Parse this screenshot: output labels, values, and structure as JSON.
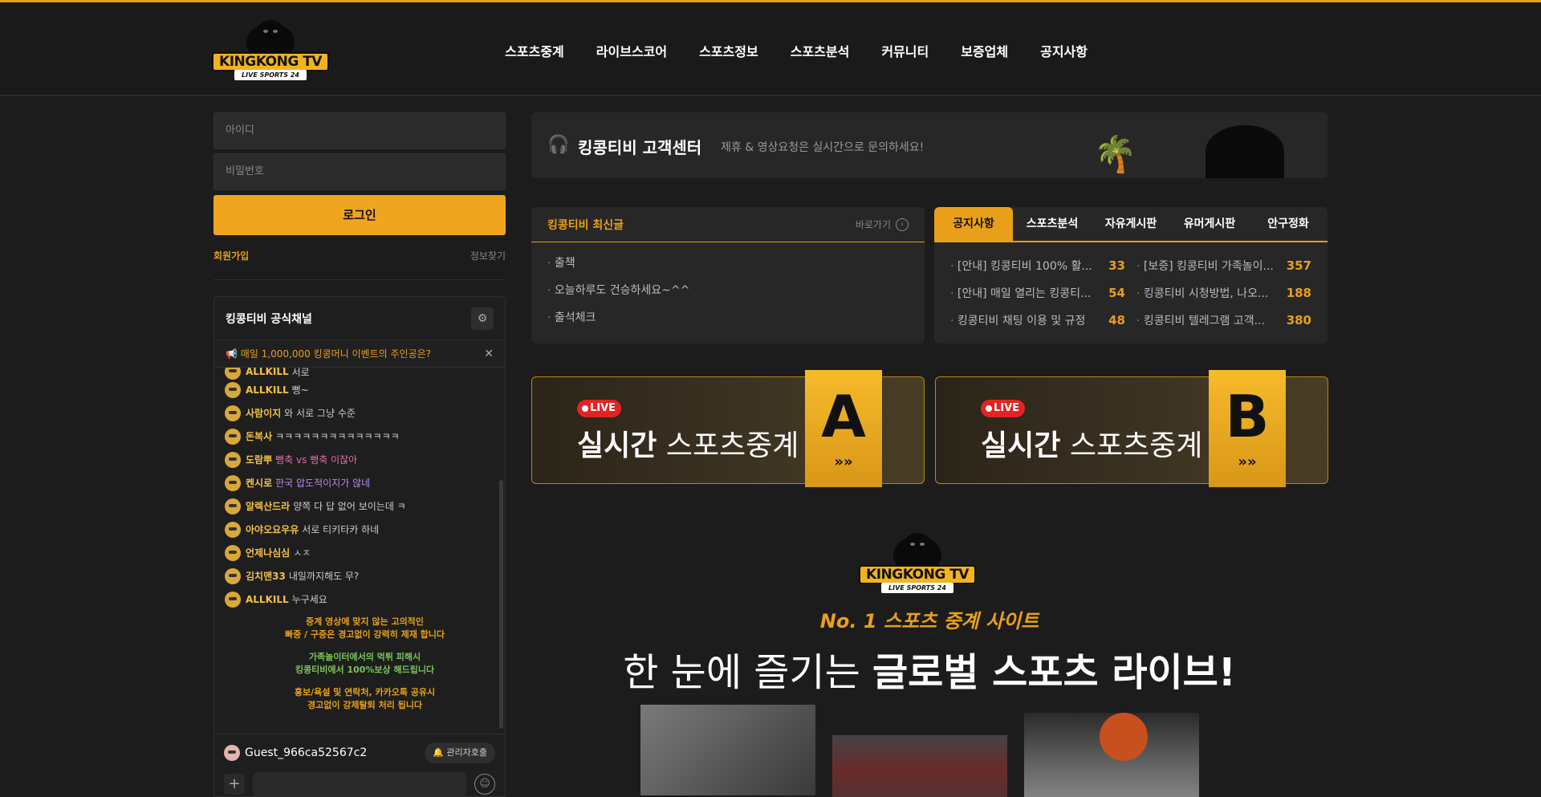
{
  "header": {
    "logo_text": "KINGKONG TV",
    "logo_sub": "LIVE SPORTS 24",
    "nav": [
      "스포츠중계",
      "라이브스코어",
      "스포츠정보",
      "스포츠분석",
      "커뮤니티",
      "보증업체",
      "공지사항"
    ]
  },
  "login": {
    "id_placeholder": "아이디",
    "pw_placeholder": "비밀번호",
    "login_label": "로그인",
    "join_label": "회원가입",
    "find_label": "정보찾기"
  },
  "chat": {
    "title": "킹콩티비 공식채널",
    "notice": "📢 매일 1,000,000 킹콩머니 이벤트의 주인공은?",
    "messages": [
      {
        "nick": "ALLKILL",
        "text": "서로",
        "style": ""
      },
      {
        "nick": "ALLKILL",
        "text": "뻥~",
        "style": ""
      },
      {
        "nick": "사람이지",
        "text": "와 서로 그냥 수준",
        "style": ""
      },
      {
        "nick": "돈복사",
        "text": "ㅋㅋㅋㅋㅋㅋㅋㅋㅋㅋㅋㅋㅋㅋ",
        "style": ""
      },
      {
        "nick": "도람뿌",
        "text": "뻥축 vs 뻥축 이잖아",
        "style": "pink"
      },
      {
        "nick": "켄시로",
        "text": "한국 압도적이지가 않네",
        "style": "purple"
      },
      {
        "nick": "알렉산드라",
        "text": "양쪽 다 답 없어 보이는데 ㅋ",
        "style": ""
      },
      {
        "nick": "아야오요우유",
        "text": "서로 티키타카 하네",
        "style": ""
      },
      {
        "nick": "언제나심심",
        "text": "ㅅㅈ",
        "style": ""
      },
      {
        "nick": "김치맨33",
        "text": "내일까지해도 무?",
        "style": ""
      },
      {
        "nick": "ALLKILL",
        "text": "누구세요",
        "style": ""
      }
    ],
    "rule1_line1": "중계 영상에 맞지 않는 고의적인",
    "rule1_line2": "빠중 / 구중은 경고없이 강력히 제재 합니다",
    "rule2_line1": "가족놀이터에서의 먹튀 피해시",
    "rule2_line2": "킹콩티비에서 100%보상 해드립니다",
    "rule3_line1": "홍보/욕설 및 연락처, 카카오톡 공유시",
    "rule3_line2": "경고없이 강제탈퇴 처리 됩니다",
    "guest_name": "Guest_966ca52567c2",
    "admin_label": "관리자호출"
  },
  "cs": {
    "title": "킹콩티비 고객센터",
    "subtitle": "제휴 & 영상요청은 실시간으로 문의하세요!"
  },
  "latest": {
    "title": "킹콩티비 최신글",
    "more_label": "바로가기",
    "items": [
      "출책",
      "오늘하루도 건승하세요~^^",
      "출석체크"
    ]
  },
  "board": {
    "tabs": [
      "공지사항",
      "스포츠분석",
      "자유게시판",
      "유머게시판",
      "안구정화"
    ],
    "items": [
      {
        "title": "[안내] 킹콩티비 100% 활...",
        "count": "33"
      },
      {
        "title": "[보증] 킹콩티비 가족놀이...",
        "count": "357"
      },
      {
        "title": "[안내] 매일 열리는 킹콩티...",
        "count": "54"
      },
      {
        "title": "킹콩티비 시청방법, 나오...",
        "count": "188"
      },
      {
        "title": "킹콩티비 채팅 이용 및 규정",
        "count": "48"
      },
      {
        "title": "킹콩티비 텔레그램 고객...",
        "count": "380"
      }
    ]
  },
  "banners": {
    "live_label": "LIVE",
    "title_bold": "실시간",
    "title_rest": " 스포츠중계",
    "a_letter": "A",
    "b_letter": "B",
    "arrow": "»»"
  },
  "promo": {
    "tagline": "No. 1 스포츠 중계 사이트",
    "headline_light": "한 눈에 즐기는 ",
    "headline_bold": "글로벌 스포츠 라이브!"
  },
  "colors": {
    "accent": "#e8a01a",
    "background": "#1c1c1c",
    "live_red": "#e02424"
  }
}
